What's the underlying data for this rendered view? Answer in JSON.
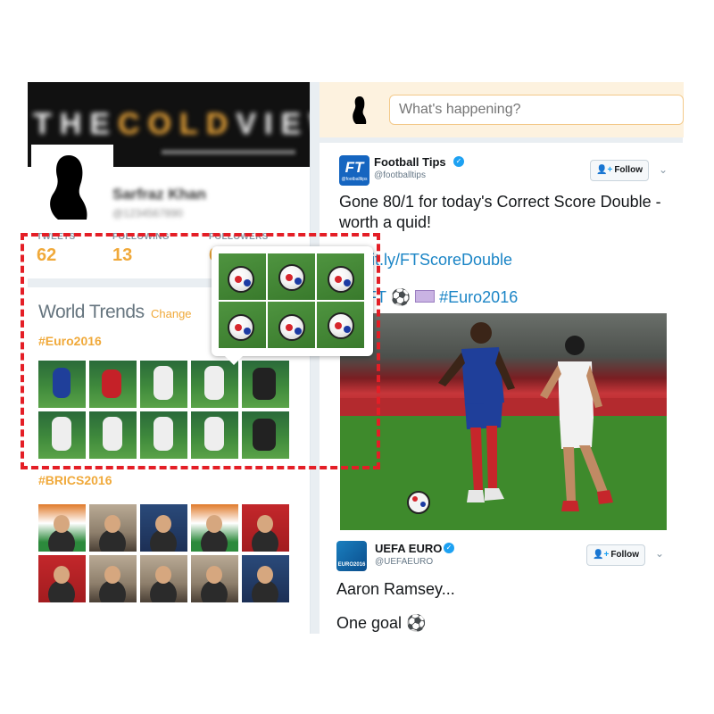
{
  "profile": {
    "banner_text_a": "THE",
    "banner_text_b": "COLD",
    "banner_text_c": "VIEWS",
    "name": "Sarfraz Khan",
    "handle": "@1234567890",
    "stats": [
      {
        "label": "TWEETS",
        "value": "62"
      },
      {
        "label": "FOLLOWING",
        "value": "13"
      },
      {
        "label": "FOLLOWERS",
        "value": "6"
      }
    ]
  },
  "trends": {
    "title": "World Trends",
    "separator": "·",
    "change_label": "Change",
    "tags": [
      "#Euro2016",
      "#BRICS2016"
    ]
  },
  "compose": {
    "placeholder": "What's happening?"
  },
  "tweets": [
    {
      "name": "Football Tips",
      "handle": "@footballtips",
      "avatar_text": "FT",
      "avatar_sub": "@footballtips",
      "follow_label": "Follow",
      "text_line1": "Gone 80/1 for today's Correct Score Double -",
      "text_line2": "worth a quid!",
      "link": "bit.ly/FTScoreDouble",
      "hashtag_partial": "sFT",
      "hashtag": "#Euro2016"
    },
    {
      "name": "UEFA EURO",
      "handle": "@UEFAEURO",
      "avatar_text": "EURO2016",
      "follow_label": "Follow",
      "text_line1": "Aaron Ramsey...",
      "text_line2": "One goal"
    }
  ],
  "colors": {
    "accent": "#f0a93a",
    "link": "#1b85c6",
    "highlight": "#e41e26",
    "verified": "#1da1f2"
  },
  "icons": {
    "verified": "verified-badge-icon",
    "follow": "add-user-icon",
    "chevron": "chevron-down-icon",
    "football": "soccer-ball-icon",
    "money": "money-bills-icon",
    "play": "play-icon"
  }
}
